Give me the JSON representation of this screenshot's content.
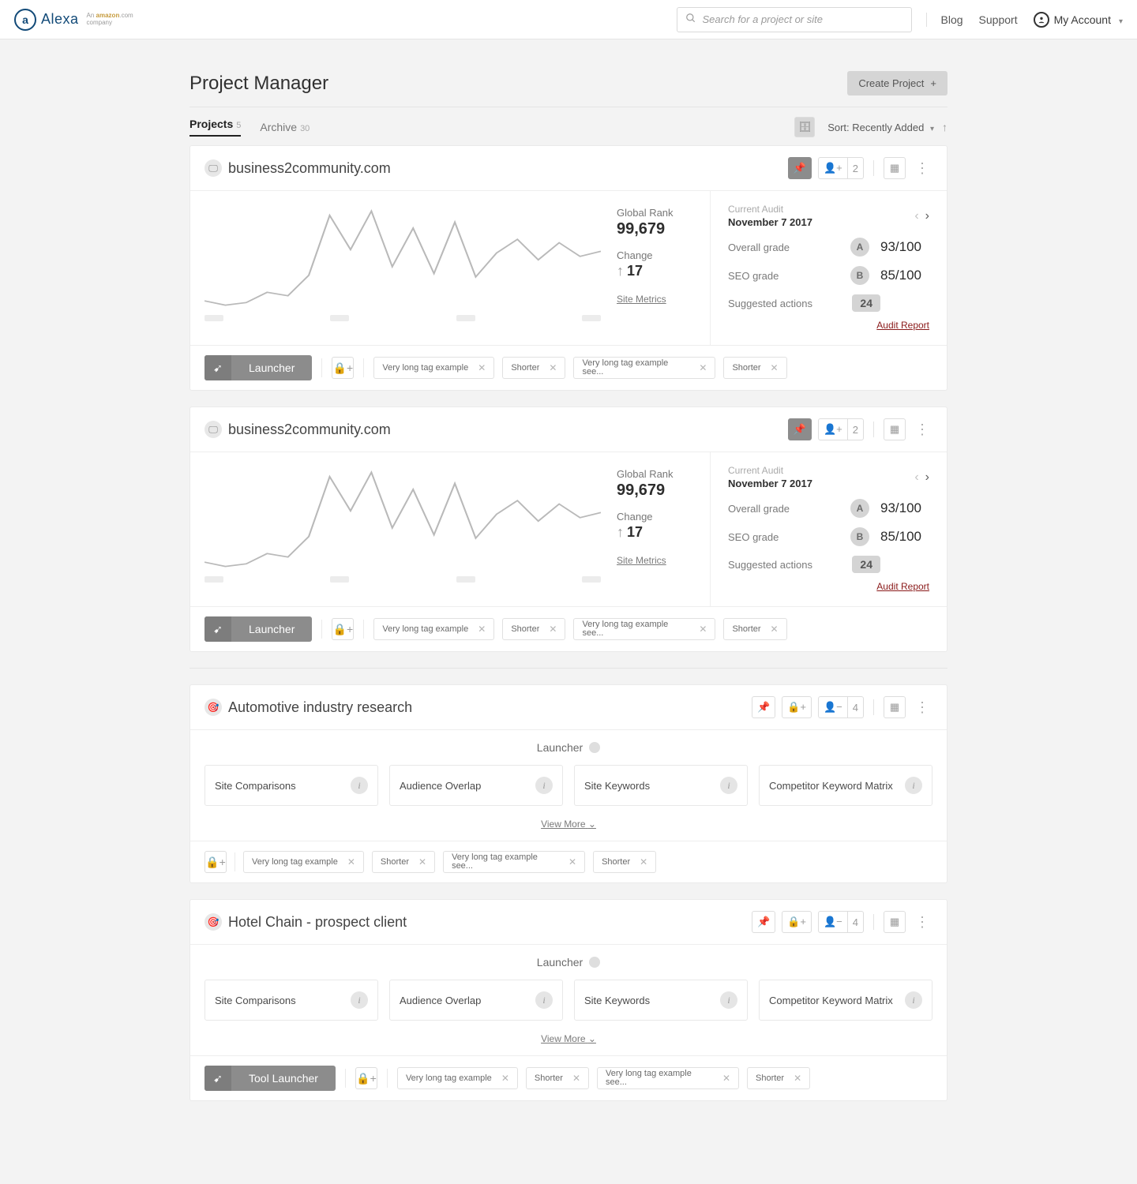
{
  "nav": {
    "logo_text": "Alexa",
    "amazon": "An amazon.com company",
    "search_placeholder": "Search for a project or site",
    "blog": "Blog",
    "support": "Support",
    "account": "My Account"
  },
  "page": {
    "title": "Project Manager",
    "create": "Create Project",
    "sort_label": "Sort: Recently Added"
  },
  "tabs": {
    "projects": {
      "label": "Projects",
      "count": "5"
    },
    "archive": {
      "label": "Archive",
      "count": "30"
    }
  },
  "projectA": {
    "title": "business2community.com",
    "share_count": "2",
    "global_rank_label": "Global Rank",
    "global_rank": "99,679",
    "change_label": "Change",
    "change": "17",
    "site_metrics": "Site Metrics",
    "audit_label": "Current Audit",
    "audit_date": "November 7 2017",
    "overall_lbl": "Overall grade",
    "overall_letter": "A",
    "overall_score": "93/100",
    "seo_lbl": "SEO grade",
    "seo_letter": "B",
    "seo_score": "85/100",
    "suggested_lbl": "Suggested actions",
    "suggested": "24",
    "audit_report": "Audit Report",
    "launcher": "Launcher",
    "tags": {
      "t1": "Very long tag example",
      "t2": "Shorter",
      "t3": "Very long tag example see...",
      "t4": "Shorter"
    }
  },
  "projectC": {
    "title": "Automotive industry research",
    "share_count": "4",
    "launcher": "Launcher",
    "tool1": "Site Comparisons",
    "tool2": "Audience Overlap",
    "tool3": "Site Keywords",
    "tool4": "Competitor Keyword Matrix",
    "view_more": "View More"
  },
  "projectD": {
    "title": "Hotel Chain - prospect client",
    "share_count": "4",
    "launcher": "Launcher",
    "tool_launcher_btn": "Tool Launcher"
  },
  "chart_data": {
    "type": "line",
    "description": "Global Rank trend sparkline (lower is better). Axes unlabeled; values are approximate relative y-positions 0–100.",
    "x": [
      0,
      1,
      2,
      3,
      4,
      5,
      6,
      7,
      8,
      9,
      10,
      11,
      12,
      13,
      14,
      15,
      16,
      17,
      18,
      19
    ],
    "values": [
      15,
      10,
      14,
      24,
      20,
      40,
      90,
      60,
      95,
      40,
      75,
      35,
      82,
      30,
      56,
      70,
      48,
      66,
      54,
      58
    ]
  }
}
